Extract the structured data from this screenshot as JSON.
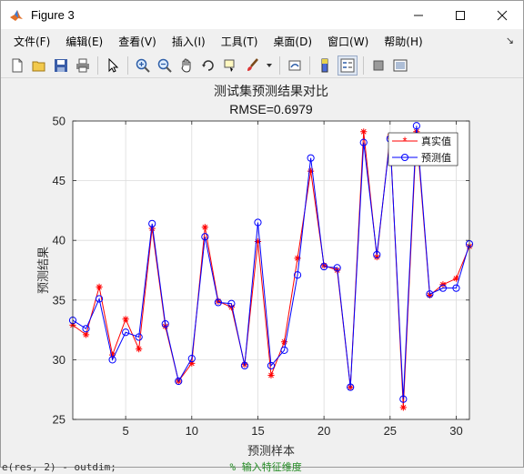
{
  "window": {
    "title": "Figure 3",
    "menu": [
      "文件(F)",
      "编辑(E)",
      "查看(V)",
      "插入(I)",
      "工具(T)",
      "桌面(D)",
      "窗口(W)",
      "帮助(H)"
    ],
    "menu_overflow_icon": "curved-arrow-icon",
    "toolbar_icons": [
      "new-figure-icon",
      "open-file-icon",
      "save-icon",
      "print-icon",
      "pointer-arrow-icon",
      "zoom-in-icon",
      "zoom-out-icon",
      "pan-hand-icon",
      "rotate-icon",
      "data-cursor-icon",
      "brush-icon",
      "link-plot-icon",
      "colorbar-icon",
      "legend-icon",
      "hide-plot-tools-icon",
      "show-plot-tools-icon"
    ]
  },
  "background_code": {
    "fragment_1": "e(res, 2) - outdim;",
    "fragment_2": "% 输入特征维度"
  },
  "chart_data": {
    "type": "line",
    "title": "测试集预测结果对比",
    "subtitle": "RMSE=0.6979",
    "xlabel": "预测样本",
    "ylabel": "预测结果",
    "xlim": [
      1,
      31
    ],
    "ylim": [
      25,
      50
    ],
    "xticks": [
      5,
      10,
      15,
      20,
      25,
      30
    ],
    "yticks": [
      25,
      30,
      35,
      40,
      45,
      50
    ],
    "grid": true,
    "legend_position": "top-right",
    "x": [
      1,
      2,
      3,
      4,
      5,
      6,
      7,
      8,
      9,
      10,
      11,
      12,
      13,
      14,
      15,
      16,
      17,
      18,
      19,
      20,
      21,
      22,
      23,
      24,
      25,
      26,
      27,
      28,
      29,
      30,
      31
    ],
    "series": [
      {
        "name": "真实值",
        "color": "#ff0000",
        "marker": "asterisk",
        "values": [
          32.9,
          32.1,
          36.1,
          30.4,
          33.4,
          30.9,
          41.0,
          32.8,
          28.2,
          29.7,
          41.1,
          34.9,
          34.4,
          29.6,
          39.9,
          28.7,
          31.5,
          38.5,
          45.8,
          37.9,
          37.5,
          27.7,
          49.1,
          38.6,
          48.7,
          26.0,
          49.1,
          35.4,
          36.3,
          36.8,
          39.5
        ]
      },
      {
        "name": "预测值",
        "color": "#0000ff",
        "marker": "circle",
        "values": [
          33.3,
          32.6,
          35.1,
          30.0,
          32.3,
          31.9,
          41.4,
          33.0,
          28.2,
          30.1,
          40.3,
          34.8,
          34.7,
          29.5,
          41.5,
          29.5,
          30.8,
          37.1,
          46.9,
          37.8,
          37.7,
          27.7,
          48.2,
          38.8,
          48.5,
          26.7,
          49.6,
          35.5,
          36.0,
          36.0,
          39.7
        ]
      }
    ]
  }
}
